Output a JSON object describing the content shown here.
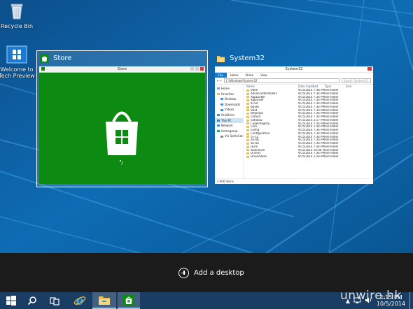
{
  "desktop_icons": [
    {
      "label": "Recycle Bin",
      "icon": "recycle-bin-icon"
    },
    {
      "label": "Welcome to Tech Preview",
      "icon": "welcome-icon"
    }
  ],
  "task_view": {
    "windows": [
      {
        "title": "Store",
        "icon": "store-icon",
        "selected": true,
        "titlebar_text": "Store"
      },
      {
        "title": "System32",
        "icon": "folder-icon",
        "selected": false
      }
    ],
    "add_desktop_label": "Add a desktop"
  },
  "explorer": {
    "window_title": "System32",
    "ribbon_tabs": [
      "File",
      "Home",
      "Share",
      "View"
    ],
    "address": "C:\\Windows\\System32",
    "search_placeholder": "Search System32",
    "nav_items": [
      "Home",
      "Favorites",
      "Desktop",
      "Downloads",
      "Videos",
      "OneDrive",
      "This PC",
      "Network",
      "Homegroup",
      "Vin SolAnCat"
    ],
    "columns": [
      "Name",
      "Date modified",
      "Type",
      "Size"
    ],
    "rows": [
      {
        "name": "0409",
        "date": "9/15/2014 7:46 PM",
        "type": "File folder"
      },
      {
        "name": "AdvancedInstallers",
        "date": "9/15/2014 7:34 PM",
        "type": "File folder"
      },
      {
        "name": "AppLocker",
        "date": "9/15/2014 7:34 PM",
        "type": "File folder"
      },
      {
        "name": "appraiser",
        "date": "9/15/2014 7:34 PM",
        "type": "File folder"
      },
      {
        "name": "ar-SA",
        "date": "9/15/2014 7:34 PM",
        "type": "File folder"
      },
      {
        "name": "bg-BG",
        "date": "9/15/2014 7:34 PM",
        "type": "File folder"
      },
      {
        "name": "Boot",
        "date": "9/15/2014 7:34 PM",
        "type": "File folder"
      },
      {
        "name": "Bthprops",
        "date": "9/15/2014 7:34 PM",
        "type": "File folder"
      },
      {
        "name": "catroot",
        "date": "9/15/2014 7:34 PM",
        "type": "File folder"
      },
      {
        "name": "catroot2",
        "date": "9/15/2014 2:17 PM",
        "type": "File folder"
      },
      {
        "name": "CodeIntegrity",
        "date": "9/15/2014 7:34 PM",
        "type": "File folder"
      },
      {
        "name": "Com",
        "date": "9/15/2014 7:34 PM",
        "type": "File folder"
      },
      {
        "name": "config",
        "date": "9/15/2014 7:34 PM",
        "type": "File folder"
      },
      {
        "name": "Configuration",
        "date": "9/15/2014 7:34 PM",
        "type": "File folder"
      },
      {
        "name": "cs-CZ",
        "date": "9/15/2014 7:34 PM",
        "type": "File folder"
      },
      {
        "name": "da-DK",
        "date": "9/15/2014 7:34 PM",
        "type": "File folder"
      },
      {
        "name": "de-DE",
        "date": "9/15/2014 7:34 PM",
        "type": "File folder"
      },
      {
        "name": "Dism",
        "date": "9/15/2014 7:34 PM",
        "type": "File folder"
      },
      {
        "name": "downlevel",
        "date": "9/15/2014 10:06 PM",
        "type": "File folder"
      },
      {
        "name": "Drivers",
        "date": "9/15/2014 7:34 PM",
        "type": "File folder"
      },
      {
        "name": "DriverStore",
        "date": "9/15/2014 2:26 PM",
        "type": "File folder"
      }
    ],
    "status": "2,900 items"
  },
  "taskbar": {
    "buttons": [
      {
        "icon": "start-windows-icon"
      },
      {
        "icon": "search-icon"
      },
      {
        "icon": "task-view-icon"
      },
      {
        "icon": "internet-explorer-icon"
      },
      {
        "icon": "file-explorer-icon"
      },
      {
        "icon": "store-icon"
      }
    ],
    "clock_time": "4:15 PM",
    "clock_date": "10/5/2014"
  },
  "watermark": "unwire.hk",
  "colors": {
    "desktop": "#0b5e9c",
    "store_green": "#0d8a11",
    "taskbar": "#1a3e63",
    "task_view_panel": "#1b1b1b"
  }
}
